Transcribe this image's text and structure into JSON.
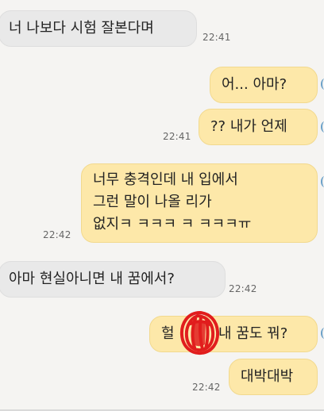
{
  "conversation": {
    "messages": [
      {
        "side": "in",
        "lines": [
          "너 나보다 시험 잘본다며"
        ],
        "time": "22:41"
      },
      {
        "side": "out",
        "lines": [
          "어... 아마?"
        ],
        "time": ""
      },
      {
        "side": "out",
        "lines": [
          "?? 내가 언제"
        ],
        "time": "22:41"
      },
      {
        "side": "out",
        "lines": [
          "너무 충격인데 내 입에서",
          "그런 말이 나올 리가",
          "없지ㅋ ㅋㅋㅋ ㅋ ㅋㅋㅋㅠ"
        ],
        "time": "22:42"
      },
      {
        "side": "in",
        "lines": [
          "아마 현실아니면 내 꿈에서?"
        ],
        "time": "22:42"
      },
      {
        "side": "out",
        "lines": [
          "헐",
          "내 꿈도 꿔?"
        ],
        "time": ""
      },
      {
        "side": "out",
        "lines": [
          "대박대박"
        ],
        "time": "22:42"
      }
    ]
  },
  "colors": {
    "incoming_bubble": "#e9e9e9",
    "outgoing_bubble": "#fde8a9",
    "scribble_red": "#e11d1d"
  },
  "annotations": {
    "redacted_scribble_icon": "red-scribble-icon"
  }
}
